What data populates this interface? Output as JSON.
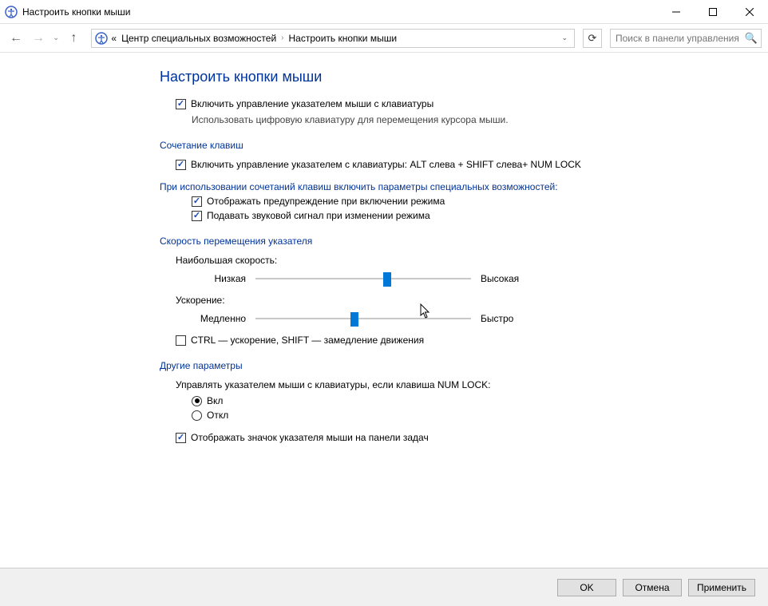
{
  "window": {
    "title": "Настроить кнопки мыши"
  },
  "breadcrumb": {
    "prefix": "«",
    "seg1": "Центр специальных возможностей",
    "seg2": "Настроить кнопки мыши"
  },
  "search": {
    "placeholder": "Поиск в панели управления"
  },
  "page": {
    "title": "Настроить кнопки мыши"
  },
  "top": {
    "enable_label": "Включить управление указателем мыши с клавиатуры",
    "enable_checked": true,
    "desc": "Использовать цифровую клавиатуру для перемещения курсора мыши."
  },
  "shortcut": {
    "header": "Сочетание клавиш",
    "enable_label": "Включить управление указателем с клавиатуры: ALT слева + SHIFT слева+ NUM LOCK",
    "enable_checked": true,
    "subhead": "При использовании сочетаний клавиш включить параметры специальных возможностей:",
    "warn_label": "Отображать предупреждение при включении режима",
    "warn_checked": true,
    "sound_label": "Подавать звуковой сигнал при изменении режима",
    "sound_checked": true
  },
  "speed": {
    "header": "Скорость перемещения указателя",
    "max_label": "Наибольшая скорость:",
    "max_left": "Низкая",
    "max_right": "Высокая",
    "max_value_pct": 61,
    "accel_label": "Ускорение:",
    "accel_left": "Медленно",
    "accel_right": "Быстро",
    "accel_value_pct": 46,
    "ctrl_label": "CTRL — ускорение, SHIFT — замедление движения",
    "ctrl_checked": false
  },
  "other": {
    "header": "Другие параметры",
    "numlock_label": "Управлять указателем мыши с клавиатуры, если клавиша NUM LOCK:",
    "on_label": "Вкл",
    "off_label": "Откл",
    "selected": "on",
    "tray_label": "Отображать значок указателя мыши на панели задач",
    "tray_checked": true
  },
  "footer": {
    "ok": "OK",
    "cancel": "Отмена",
    "apply": "Применить"
  }
}
